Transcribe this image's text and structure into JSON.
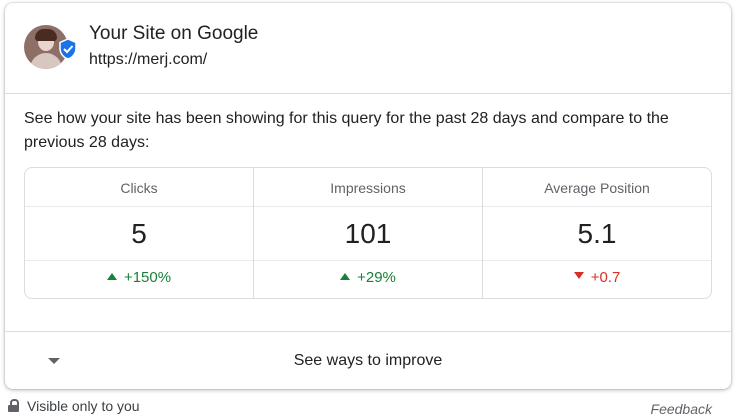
{
  "site": {
    "title": "Your Site on Google",
    "url": "https://merj.com/"
  },
  "description": "See how your site has been showing for this query for the past 28 days and compare to the previous 28 days:",
  "stats": [
    {
      "label": "Clicks",
      "value": "5",
      "change": "+150%",
      "direction": "up"
    },
    {
      "label": "Impressions",
      "value": "101",
      "change": "+29%",
      "direction": "up"
    },
    {
      "label": "Average Position",
      "value": "5.1",
      "change": "+0.7",
      "direction": "down"
    }
  ],
  "improve_label": "See ways to improve",
  "visibility_note": "Visible only to you",
  "feedback_label": "Feedback",
  "colors": {
    "positive": "#188038",
    "negative": "#d93025",
    "verified_badge": "#1a73e8"
  },
  "icons": {
    "verified": "verified-badge-icon",
    "expand": "chevron-down-icon",
    "lock": "lock-icon"
  }
}
